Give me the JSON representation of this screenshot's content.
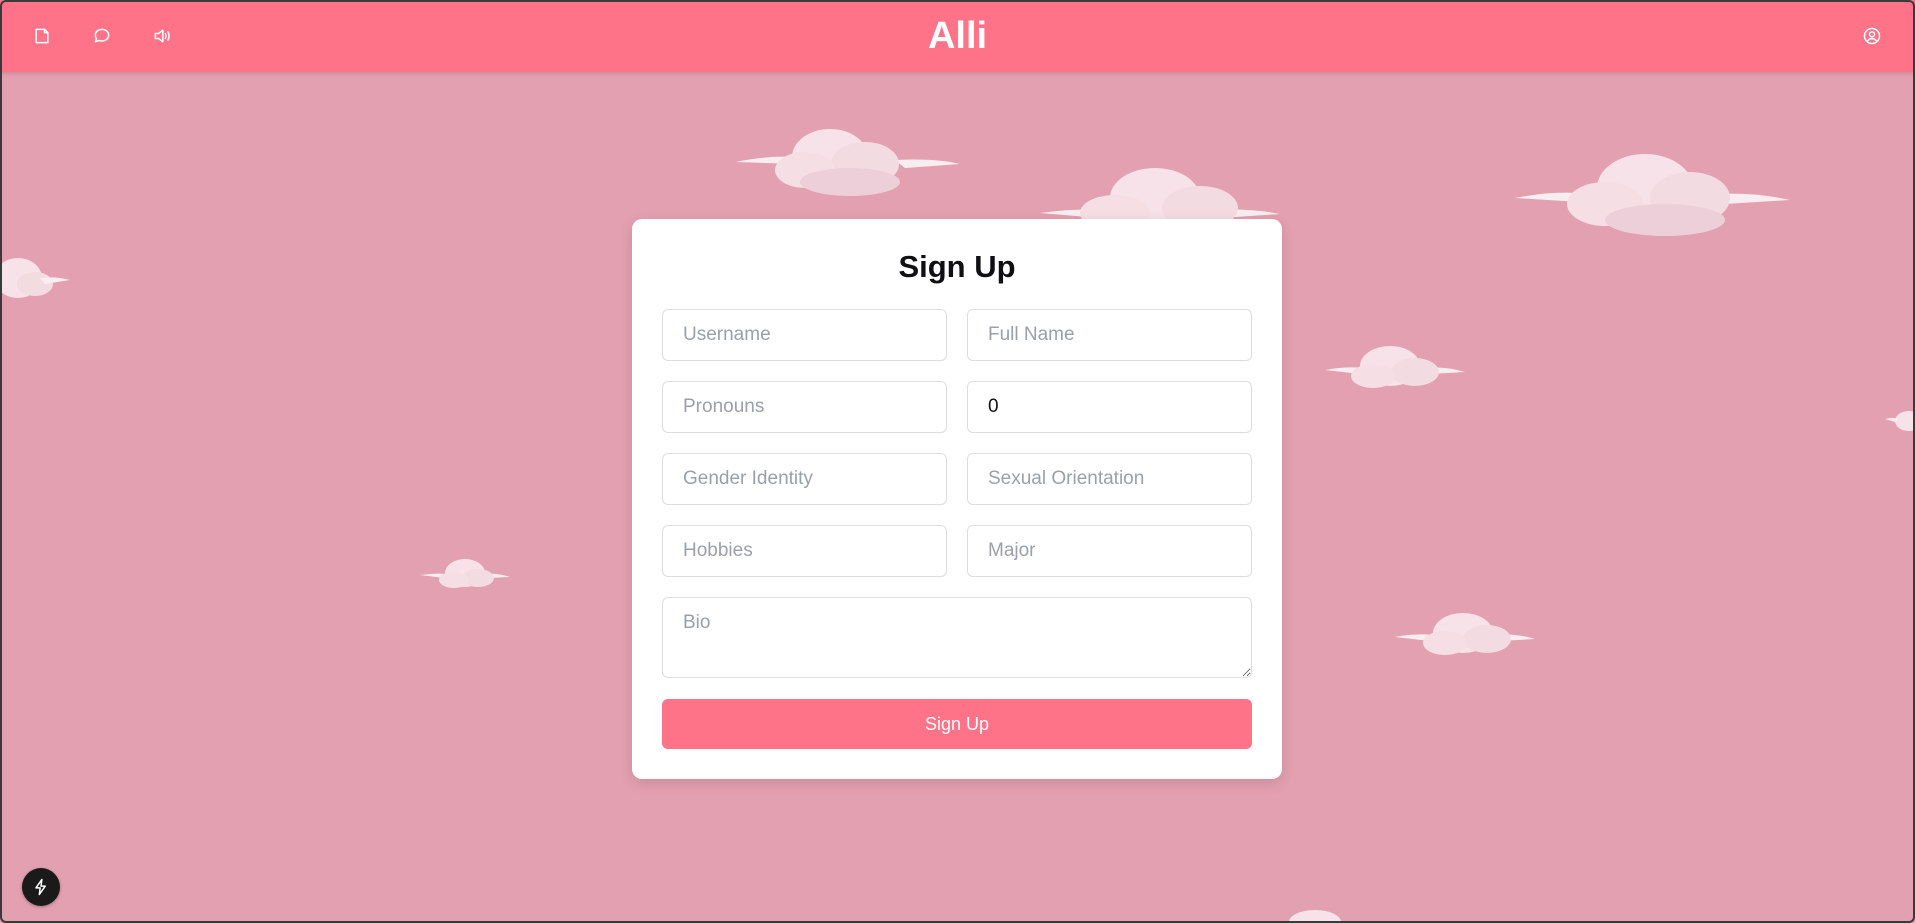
{
  "header": {
    "title": "Alli",
    "icons": [
      "document-icon",
      "chat-icon",
      "speaker-icon",
      "user-circle-icon"
    ]
  },
  "signup": {
    "title": "Sign Up",
    "fields": {
      "username": {
        "placeholder": "Username",
        "value": ""
      },
      "full_name": {
        "placeholder": "Full Name",
        "value": ""
      },
      "pronouns": {
        "placeholder": "Pronouns",
        "value": ""
      },
      "age": {
        "placeholder": "",
        "value": "0"
      },
      "gender_identity": {
        "placeholder": "Gender Identity",
        "value": ""
      },
      "sexual_orientation": {
        "placeholder": "Sexual Orientation",
        "value": ""
      },
      "hobbies": {
        "placeholder": "Hobbies",
        "value": ""
      },
      "major": {
        "placeholder": "Major",
        "value": ""
      },
      "bio": {
        "placeholder": "Bio",
        "value": ""
      }
    },
    "submit_label": "Sign Up"
  },
  "floating_button": {
    "icon": "lightning-icon"
  },
  "colors": {
    "background": "#e3a0b0",
    "accent": "#fe7387",
    "card": "#ffffff",
    "cloud": "#f5e1e6"
  }
}
